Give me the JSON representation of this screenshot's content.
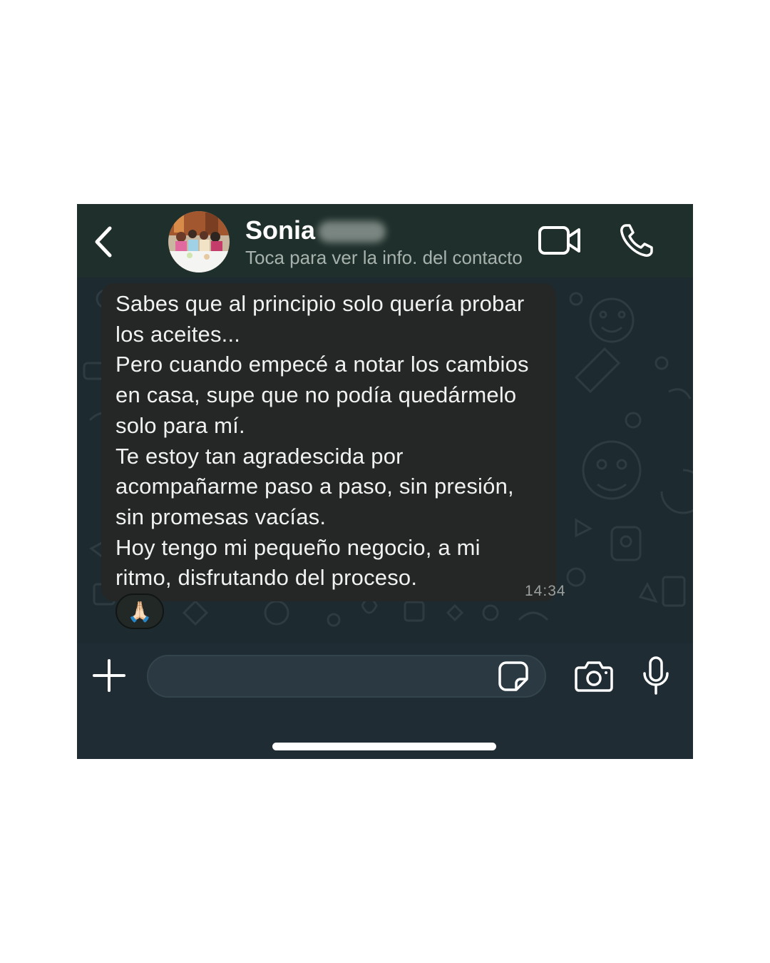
{
  "header": {
    "contact_name": "Sonia",
    "contact_subtitle": "Toca para ver la info. del contacto",
    "icons": {
      "back": "chevron-left-icon",
      "video": "video-camera-icon",
      "call": "phone-icon"
    }
  },
  "message": {
    "lines": [
      "Sabes que al principio solo quería probar",
      "los aceites...",
      "Pero cuando empecé a notar los cambios",
      "en casa, supe que no podía quedármelo",
      "solo para mí.",
      "Te estoy tan agradescida por",
      "acompañarme paso a paso, sin presión,",
      "sin promesas vacías.",
      "Hoy tengo mi pequeño negocio, a mi",
      "ritmo, disfrutando del proceso."
    ],
    "time": "14:34",
    "reaction": "🙏🏻"
  },
  "composer": {
    "input_value": "",
    "icons": {
      "attach": "plus-icon",
      "sticker": "sticker-icon",
      "camera": "camera-icon",
      "mic": "microphone-icon"
    }
  },
  "colors": {
    "header_bg": "#1f2f2b",
    "chat_bg": "#1d2a2f",
    "bubble_bg": "#242726",
    "composer_bg": "#1f2c33",
    "text": "#f1f1f1"
  }
}
